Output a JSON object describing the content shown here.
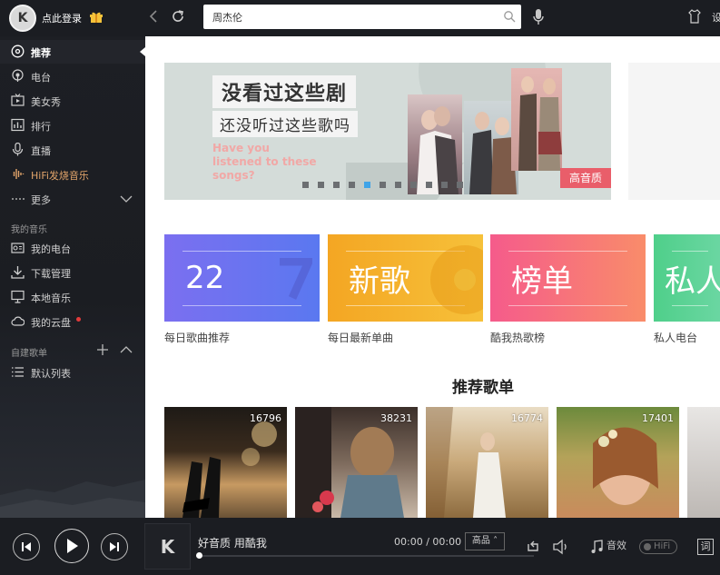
{
  "header": {
    "login_label": "点此登录",
    "search_value": "周杰伦",
    "cut_char": "设",
    "avatar_letter": "K"
  },
  "sidebar": {
    "main_items": [
      {
        "label": "推荐",
        "icon": "disc-icon",
        "active": true
      },
      {
        "label": "电台",
        "icon": "radio-icon"
      },
      {
        "label": "美女秀",
        "icon": "tv-icon"
      },
      {
        "label": "排行",
        "icon": "chart-icon"
      },
      {
        "label": "直播",
        "icon": "mic-icon"
      },
      {
        "label": "HiFi发烧音乐",
        "icon": "waveform-icon"
      },
      {
        "label": "更多",
        "icon": "dots-icon"
      }
    ],
    "my_music_title": "我的音乐",
    "my_music_items": [
      {
        "label": "我的电台",
        "icon": "radio-box-icon"
      },
      {
        "label": "下载管理",
        "icon": "download-icon"
      },
      {
        "label": "本地音乐",
        "icon": "monitor-icon"
      },
      {
        "label": "我的云盘",
        "icon": "cloud-icon"
      }
    ],
    "playlist_title": "自建歌单",
    "playlist_items": [
      {
        "label": "默认列表",
        "icon": "list-icon"
      }
    ]
  },
  "banner": {
    "title1": "没看过这些剧",
    "title2": "还没听过这些歌吗",
    "english": "Have you listened to these songs?",
    "badge": "高音质",
    "dot_count": 11,
    "active_dot": 4
  },
  "cards": [
    {
      "big": "22",
      "label": "每日歌曲推荐",
      "color1": "#7b6ff0",
      "color2": "#5a78f0"
    },
    {
      "big": "新歌",
      "label": "每日最新单曲",
      "color1": "#f4a623",
      "color2": "#f6c13a"
    },
    {
      "big": "榜单",
      "label": "酷我热歌榜",
      "color1": "#f55b8b",
      "color2": "#f98c6a"
    },
    {
      "big": "私人",
      "label": "私人电台",
      "color1": "#4fcf8a",
      "color2": "#6dd7a4"
    }
  ],
  "recommend": {
    "title": "推荐歌单",
    "playlists": [
      {
        "count": "16796"
      },
      {
        "count": "38231"
      },
      {
        "count": "16774"
      },
      {
        "count": "17401"
      },
      {
        "count": ""
      }
    ]
  },
  "player": {
    "song": "好音质 用酷我",
    "time": "00:00 / 00:00",
    "quality": "高品",
    "effect": "音效",
    "hifi": "HiFi",
    "lyric": "词",
    "progress": 0
  },
  "colors": {
    "dark_bg": "#1b1d22",
    "accent_hifi": "#e1a46a",
    "badge": "#e95e6a",
    "active_dot": "#3fa4e8"
  }
}
